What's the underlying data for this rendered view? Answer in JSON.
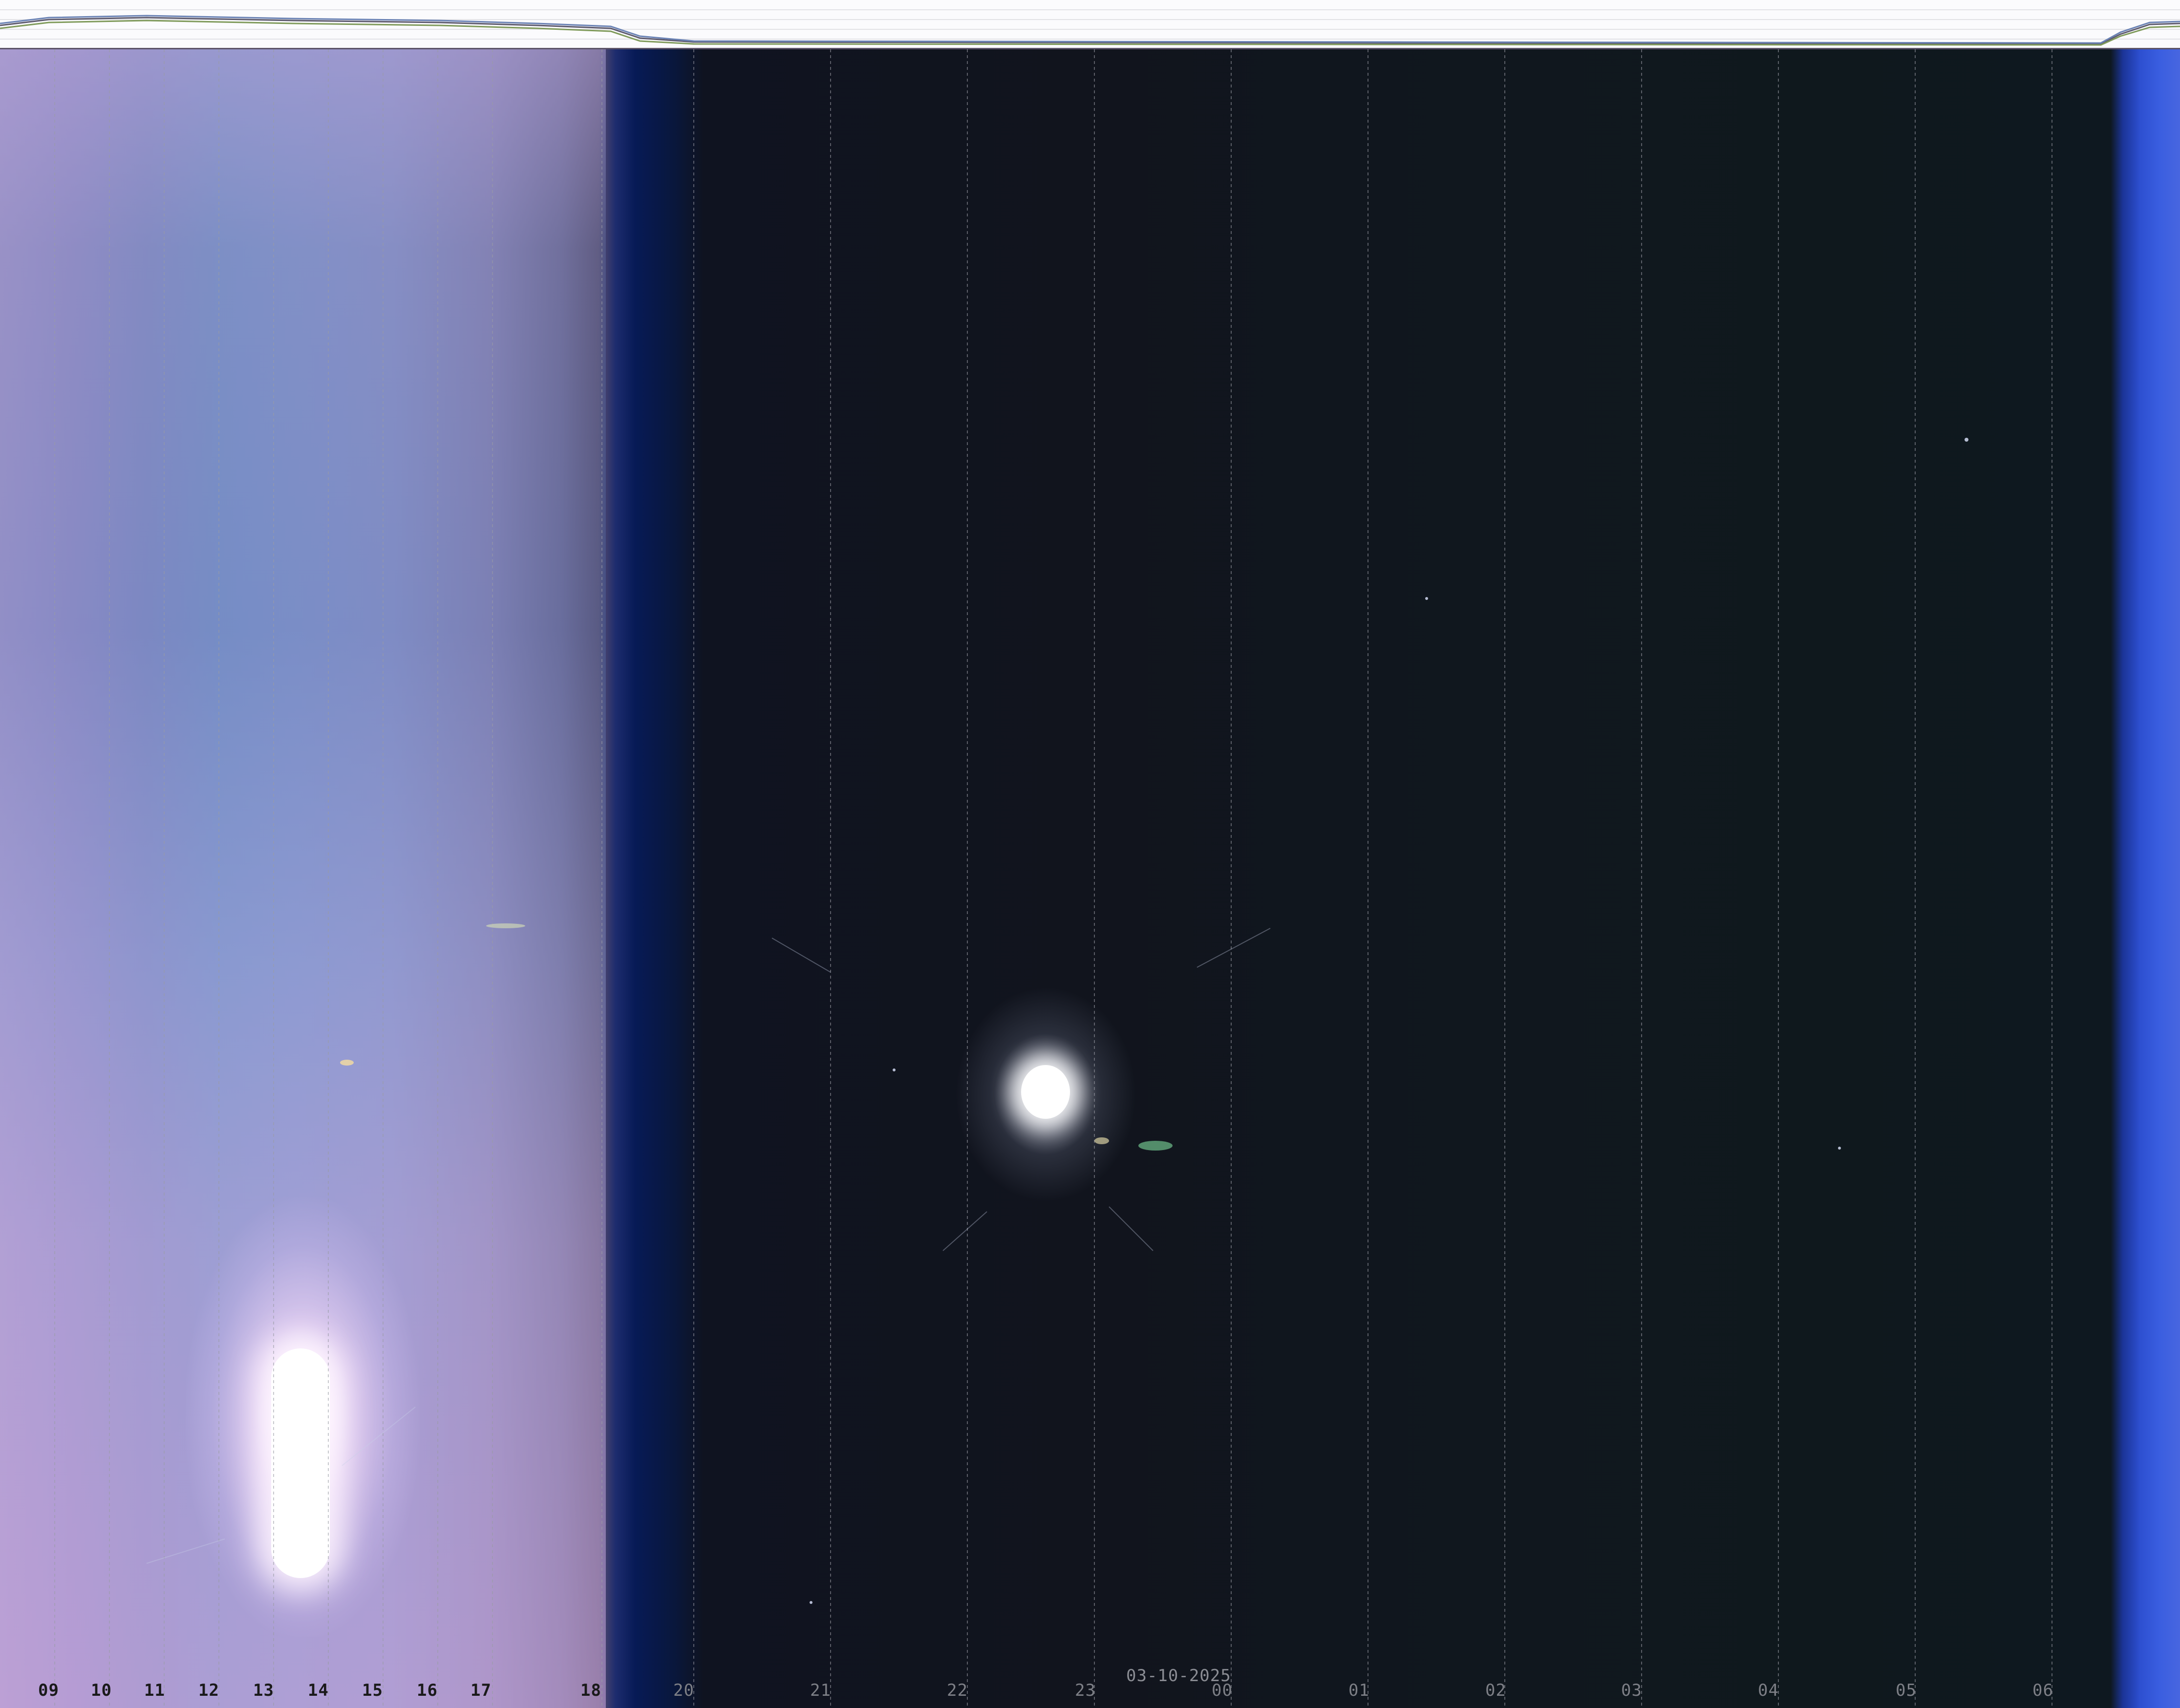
{
  "date": "03-10-2025",
  "hour_labels": [
    "09",
    "10",
    "11",
    "12",
    "13",
    "14",
    "15",
    "16",
    "17",
    "18",
    "20",
    "21",
    "22",
    "23",
    "00",
    "01",
    "02",
    "03",
    "04",
    "05",
    "06"
  ],
  "colors": {
    "day_sky": "#8890c6",
    "twilight": "#071a56",
    "night_sky": "#11141d",
    "dawn": "#3a5ee0",
    "gridline": "#9a9ca5"
  }
}
